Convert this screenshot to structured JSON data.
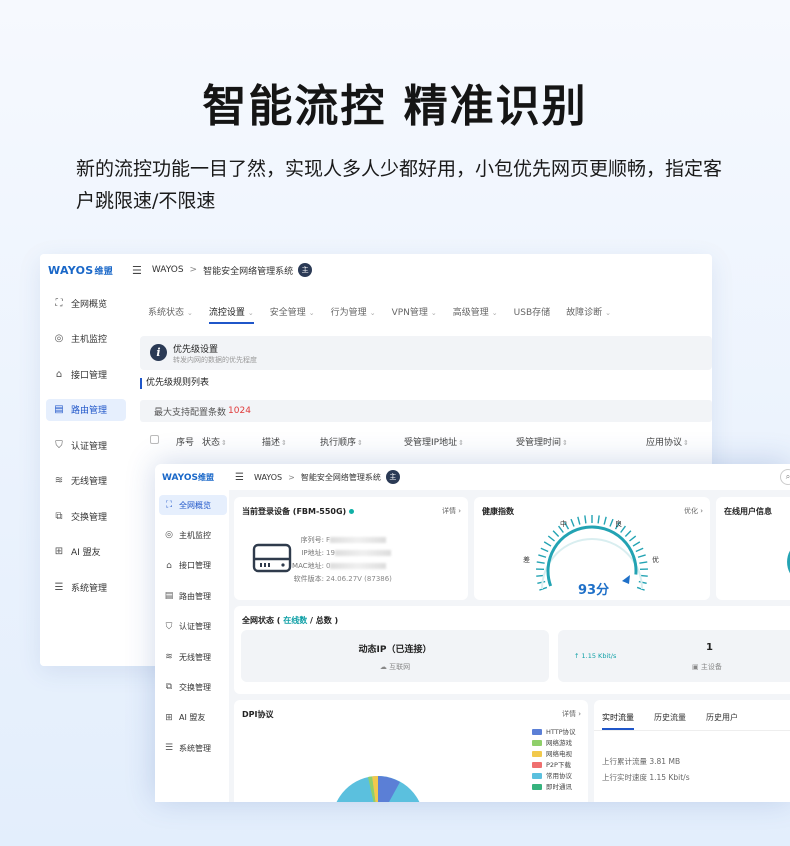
{
  "headline": "智能流控 精准识别",
  "subtext": "新的流控功能一目了然，实现人多人少都好用，小包优先网页更顺畅，指定客户跳限速/不限速",
  "colors": {
    "brand_blue": "#1967c8",
    "accent": "#1f56c9",
    "teal": "#10b0a6",
    "alert_red": "#e03b3b"
  },
  "back_window": {
    "logo": "WAYOS",
    "logo_cn": "维盟",
    "nav": [
      {
        "label": "全网概览",
        "icon": "network-icon"
      },
      {
        "label": "主机监控",
        "icon": "user-circle-icon"
      },
      {
        "label": "接口管理",
        "icon": "port-icon"
      },
      {
        "label": "路由管理",
        "icon": "router-icon",
        "active": true
      },
      {
        "label": "认证管理",
        "icon": "shield-icon"
      },
      {
        "label": "无线管理",
        "icon": "wifi-icon"
      },
      {
        "label": "交换管理",
        "icon": "switch-icon"
      },
      {
        "label": "AI 盟友",
        "icon": "ai-icon"
      },
      {
        "label": "系统管理",
        "icon": "sliders-icon"
      }
    ],
    "breadcrumb": {
      "root": "WAYOS",
      "sep": ">",
      "title": "智能安全网络管理系统",
      "badge": "主"
    },
    "tabs": [
      {
        "label": "系统状态",
        "chevron": true
      },
      {
        "label": "流控设置",
        "chevron": true,
        "active": true
      },
      {
        "label": "安全管理",
        "chevron": true
      },
      {
        "label": "行为管理",
        "chevron": true
      },
      {
        "label": "VPN管理",
        "chevron": true
      },
      {
        "label": "高级管理",
        "chevron": true
      },
      {
        "label": "USB存储",
        "chevron": false
      },
      {
        "label": "故障诊断",
        "chevron": true
      }
    ],
    "info": {
      "title": "优先级设置",
      "desc": "转发内网的数据的优先程度"
    },
    "list_title": "优先级规则列表",
    "max_config": {
      "label": "最大支持配置条数",
      "value": "1024"
    },
    "table_columns": [
      "序号",
      "状态",
      "描述",
      "执行顺序",
      "受管理IP地址",
      "受管理时间",
      "应用协议"
    ]
  },
  "front_window": {
    "logo": "WAYOS",
    "logo_cn": "维盟",
    "nav": [
      {
        "label": "全网概览",
        "icon": "network-icon",
        "active": true
      },
      {
        "label": "主机监控",
        "icon": "user-circle-icon"
      },
      {
        "label": "接口管理",
        "icon": "port-icon"
      },
      {
        "label": "路由管理",
        "icon": "router-icon"
      },
      {
        "label": "认证管理",
        "icon": "shield-icon"
      },
      {
        "label": "无线管理",
        "icon": "wifi-icon"
      },
      {
        "label": "交换管理",
        "icon": "switch-icon"
      },
      {
        "label": "AI 盟友",
        "icon": "ai-icon"
      },
      {
        "label": "系统管理",
        "icon": "sliders-icon"
      }
    ],
    "breadcrumb": {
      "root": "WAYOS",
      "sep": ">",
      "title": "智能安全网络管理系统",
      "badge": "主"
    },
    "device": {
      "title": "当前登录设备 (FBM-550G)",
      "link": "详情",
      "fields": [
        {
          "key": "序列号:",
          "value": "F"
        },
        {
          "key": "IP地址:",
          "value": "19"
        },
        {
          "key": "MAC地址:",
          "value": "0"
        },
        {
          "key": "软件版本:",
          "value": "24.06.27V (87386)"
        }
      ]
    },
    "health": {
      "title": "健康指数",
      "link": "优化",
      "score": "93分",
      "score_value": 93,
      "labels": {
        "low": "差",
        "mid": "中",
        "good": "良",
        "best": "优"
      }
    },
    "online_users": {
      "title": "在线用户信息"
    },
    "net_status": {
      "title": "全网状态",
      "online": "在线数",
      "total": "总数",
      "left_main": "动态IP（已连接）",
      "left_sub": "互联网",
      "right_rate": "↑ 1.15 Kbit/s",
      "right_count": "1",
      "right_sub": "主设备"
    },
    "dpi": {
      "title": "DPI协议",
      "link": "详情",
      "legend": [
        {
          "label": "HTTP协议",
          "color": "#5b7fd6"
        },
        {
          "label": "网络游戏",
          "color": "#8fcf6a"
        },
        {
          "label": "网络电视",
          "color": "#f2c94c"
        },
        {
          "label": "P2P下载",
          "color": "#ef6f6f"
        },
        {
          "label": "常用协议",
          "color": "#5bc0de"
        },
        {
          "label": "即时通讯",
          "color": "#36b37e"
        }
      ]
    },
    "traffic": {
      "tabs": [
        {
          "label": "实时流量",
          "active": true
        },
        {
          "label": "历史流量"
        },
        {
          "label": "历史用户"
        }
      ],
      "upload_total": "上行累计流量 3.81 MB",
      "upload_rate": "上行实时速度 1.15 Kbit/s"
    }
  }
}
